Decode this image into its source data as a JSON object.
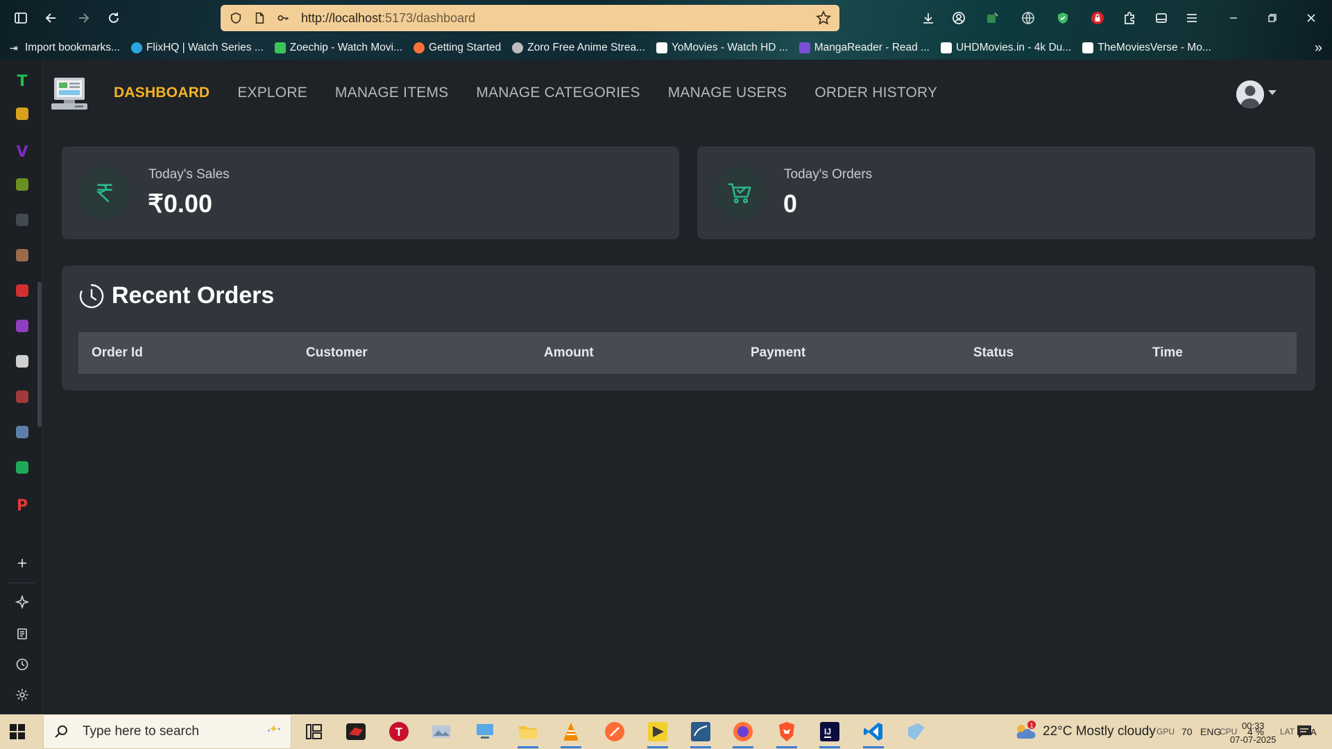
{
  "browser": {
    "url_host": "http://localhost",
    "url_rest": ":5173/dashboard",
    "bookmarks": [
      {
        "label": "Import bookmarks...",
        "color": "#ffffff"
      },
      {
        "label": "FlixHQ | Watch Series ...",
        "color": "#2aa7e0"
      },
      {
        "label": "Zoechip - Watch Movi...",
        "color": "#3cc45a"
      },
      {
        "label": "Getting Started",
        "color": "#ff7139"
      },
      {
        "label": "Zoro Free Anime Strea...",
        "color": "#bdbdbd"
      },
      {
        "label": "YoMovies - Watch HD ...",
        "color": "#ffffff"
      },
      {
        "label": "MangaReader - Read ...",
        "color": "#7a4fd6"
      },
      {
        "label": "UHDMovies.in - 4k Du...",
        "color": "#ffffff"
      },
      {
        "label": "TheMoviesVerse - Mo...",
        "color": "#ffffff"
      }
    ]
  },
  "sidepanel": {
    "items": [
      {
        "name": "sidepanel-item-1",
        "glyph": "T",
        "color": "#1fbf4b"
      },
      {
        "name": "sidepanel-item-2",
        "glyph": "",
        "color": "#d9a21b"
      },
      {
        "name": "sidepanel-item-3",
        "glyph": "V",
        "color": "#7b2cbf"
      },
      {
        "name": "sidepanel-item-4",
        "glyph": "",
        "color": "#6a8f22"
      },
      {
        "name": "sidepanel-item-5",
        "glyph": "",
        "color": "#444a52"
      },
      {
        "name": "sidepanel-item-6",
        "glyph": "",
        "color": "#9a6b4a"
      },
      {
        "name": "sidepanel-item-7",
        "glyph": "",
        "color": "#d32f2f"
      },
      {
        "name": "sidepanel-item-8",
        "glyph": "",
        "color": "#8e3fbf"
      },
      {
        "name": "sidepanel-item-9",
        "glyph": "",
        "color": "#d0d0d0"
      },
      {
        "name": "sidepanel-item-10",
        "glyph": "",
        "color": "#a33a3a"
      },
      {
        "name": "sidepanel-item-11",
        "glyph": "",
        "color": "#5b7fa8"
      },
      {
        "name": "sidepanel-item-12",
        "glyph": "",
        "color": "#1faa5a"
      },
      {
        "name": "sidepanel-item-13",
        "glyph": "P",
        "color": "#e53935"
      }
    ]
  },
  "nav": {
    "links": [
      "DASHBOARD",
      "EXPLORE",
      "MANAGE ITEMS",
      "MANAGE CATEGORIES",
      "MANAGE USERS",
      "ORDER HISTORY"
    ],
    "active": "DASHBOARD"
  },
  "stats": {
    "sales": {
      "label": "Today's Sales",
      "value": "₹0.00",
      "icon": "rupee-icon"
    },
    "orders": {
      "label": "Today's Orders",
      "value": "0",
      "icon": "cart-icon"
    }
  },
  "recent_orders": {
    "title": "Recent Orders",
    "columns": [
      "Order Id",
      "Customer",
      "Amount",
      "Payment",
      "Status",
      "Time"
    ],
    "rows": []
  },
  "taskbar": {
    "search_placeholder": "Type here to search",
    "weather": "22°C  Mostly cloudy",
    "weather_badge": "1",
    "gpu_label": "GPU",
    "gpu_value": "70",
    "lang": "ENG",
    "cpu_label": "CPU",
    "cpu_value": "4 %",
    "lat_label": "LAT",
    "lat_value": "N/A",
    "time": "00:33",
    "date": "07-07-2025"
  },
  "colors": {
    "accent": "#f5b324",
    "stat_icon": "#28b98b",
    "card": "#31353c",
    "table_header": "#464b54"
  }
}
